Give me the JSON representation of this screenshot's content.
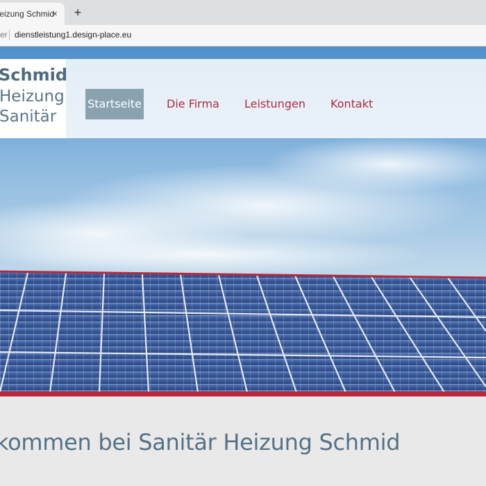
{
  "browser": {
    "tab_title": "Heizung Schmid",
    "tab_close_glyph": "×",
    "new_tab_glyph": "+",
    "omnibox_left_text": "er",
    "url": "dienstleistung1.design-place.eu"
  },
  "site": {
    "logo": {
      "line1": "Schmid",
      "line2": "Heizung",
      "line3": "Sanitär"
    },
    "nav": [
      {
        "label": "Startseite",
        "active": true
      },
      {
        "label": "Die Firma",
        "active": false
      },
      {
        "label": "Leistungen",
        "active": false
      },
      {
        "label": "Kontakt",
        "active": false
      }
    ],
    "welcome_heading": "kommen bei Sanitär Heizung Schmid"
  },
  "colors": {
    "accent": "#b3283f",
    "nav_active_bg": "#8aa2b0",
    "heading": "#557184",
    "logo_text": "#4d6a7e"
  }
}
